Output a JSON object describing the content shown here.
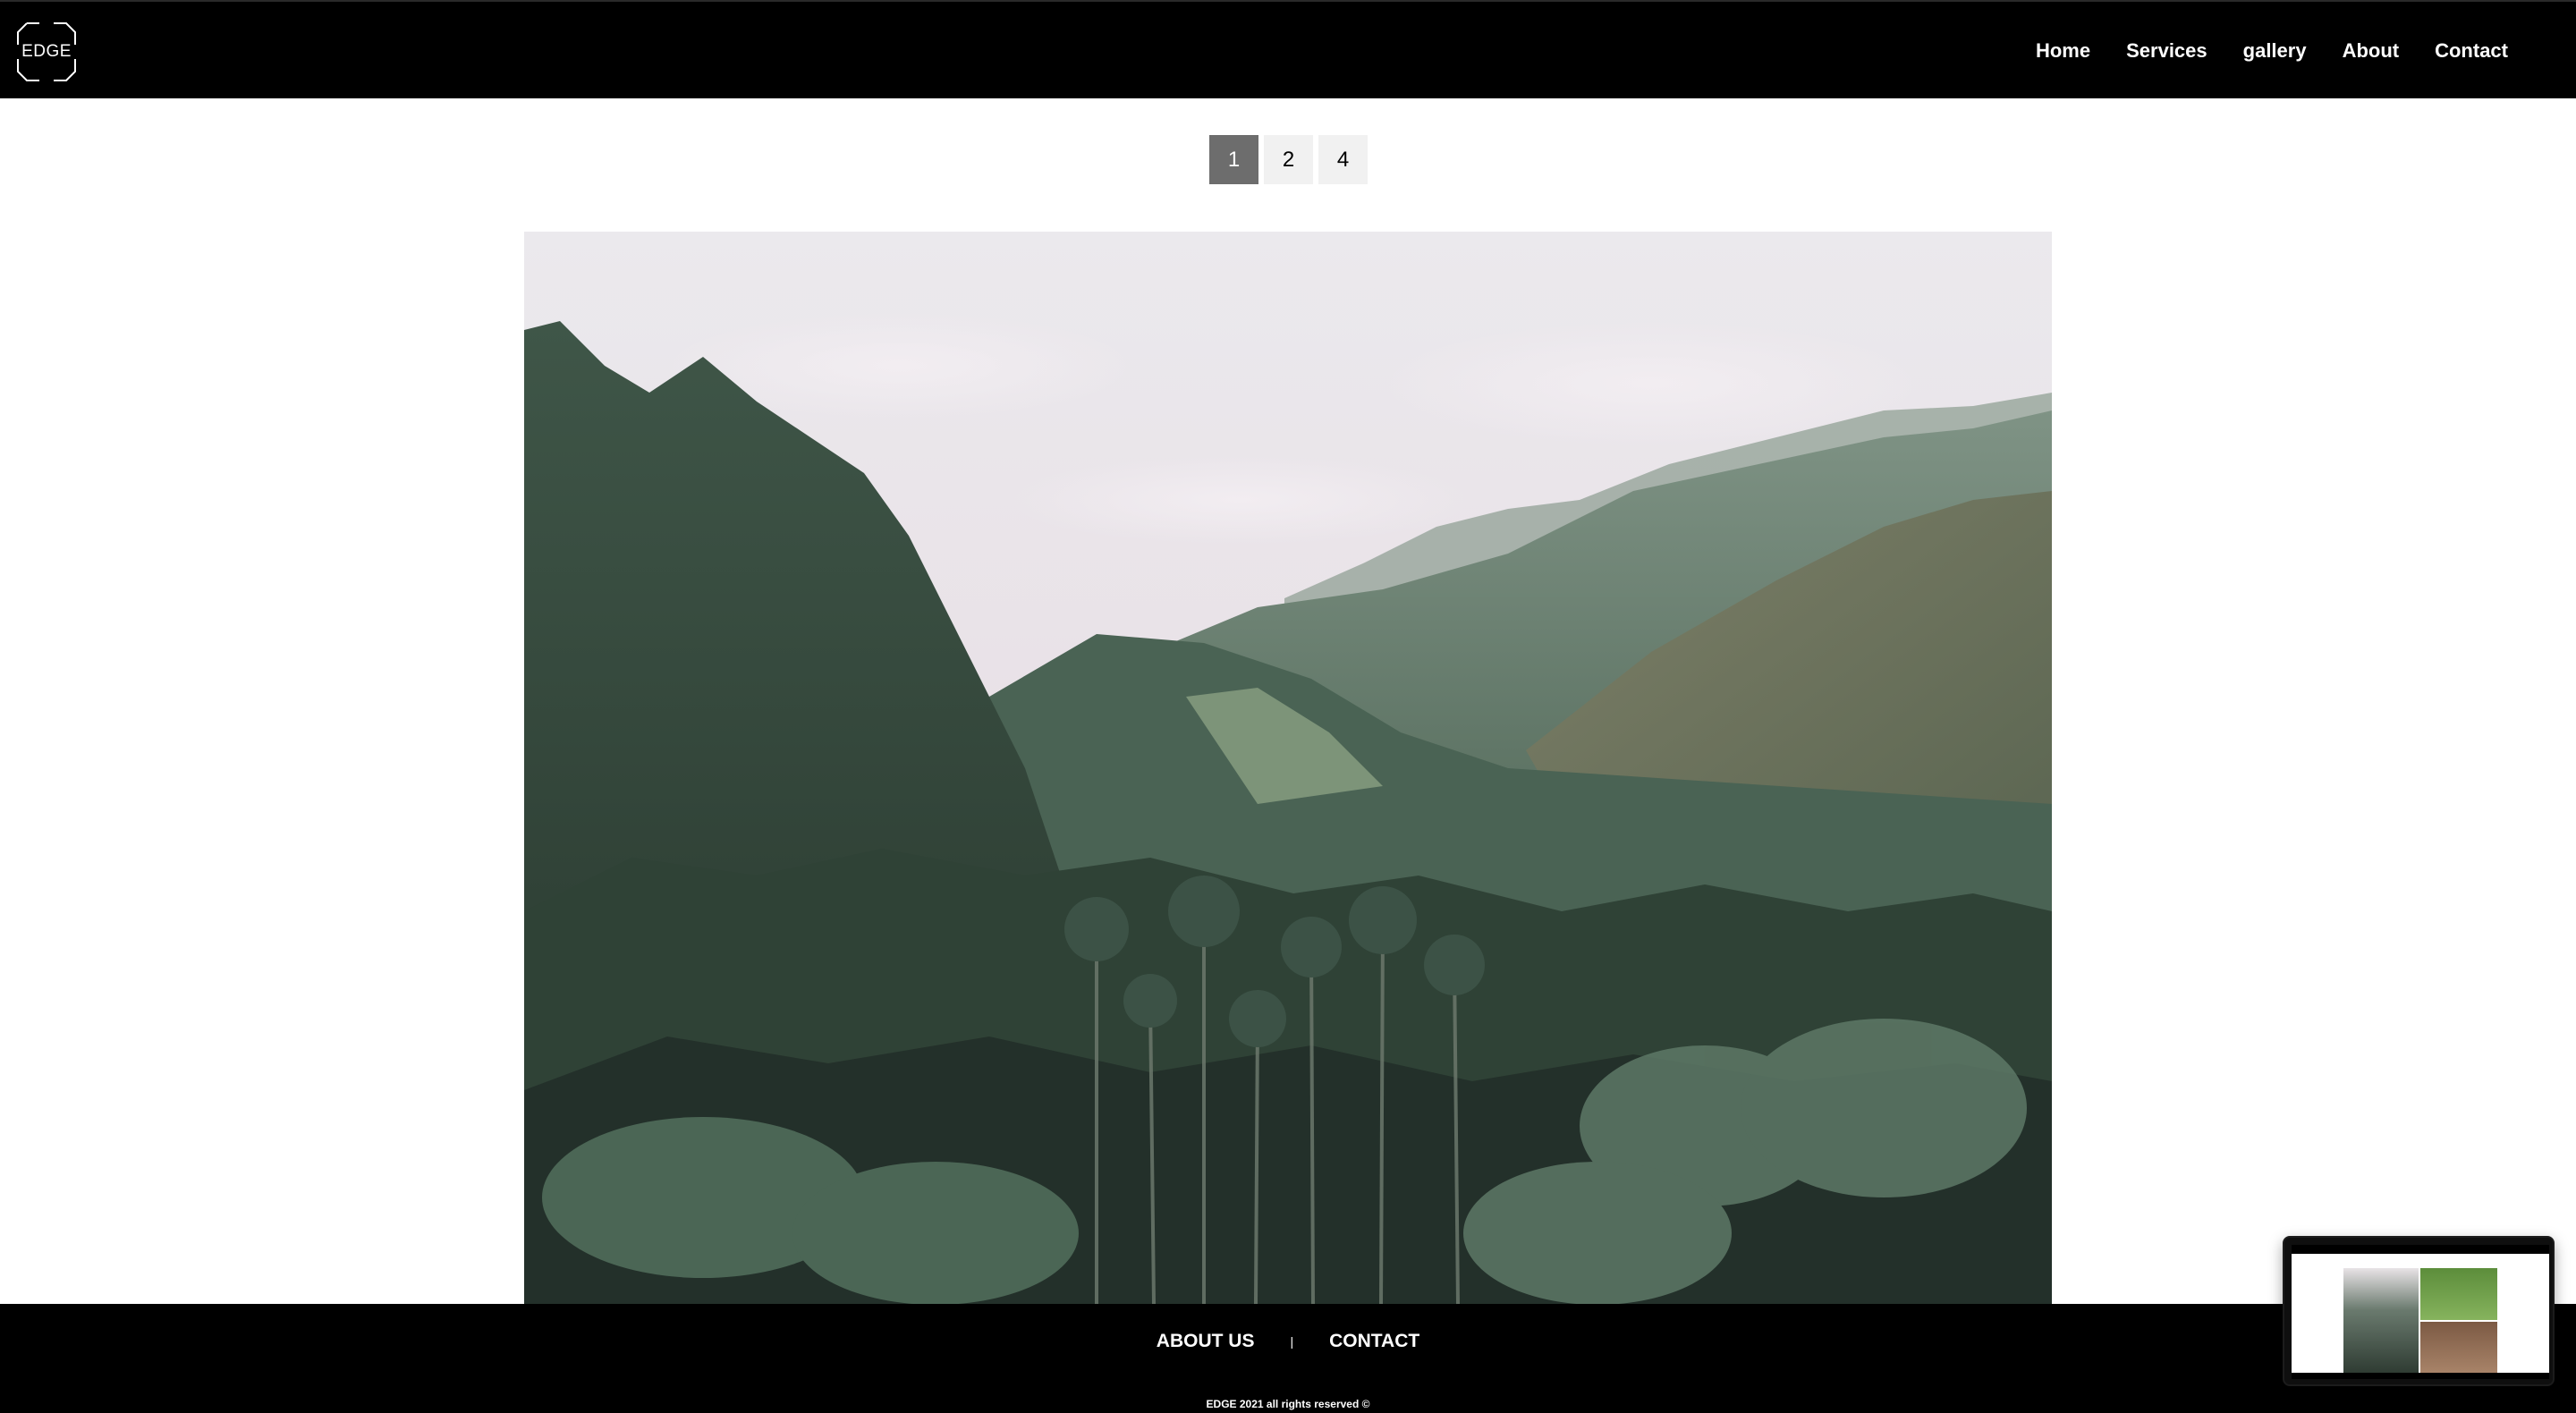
{
  "brand": {
    "logo_text": "EDGE"
  },
  "nav": {
    "items": [
      {
        "label": "Home"
      },
      {
        "label": "Services"
      },
      {
        "label": "gallery"
      },
      {
        "label": "About"
      },
      {
        "label": "Contact"
      }
    ]
  },
  "pagination": {
    "pages": [
      "1",
      "2",
      "4"
    ],
    "active": "1"
  },
  "main": {
    "photo_subject": "misty forested mountain valley with palm trees"
  },
  "footer": {
    "links": [
      {
        "label": "ABOUT US"
      },
      {
        "label": "CONTACT"
      }
    ],
    "separator": "|",
    "copyright": "EDGE 2021 all rights reserved ©"
  },
  "colors": {
    "header_bg": "#000000",
    "footer_bg": "#000000",
    "page_active_bg": "#6d6d6d",
    "page_bg": "#f1f1f1"
  }
}
